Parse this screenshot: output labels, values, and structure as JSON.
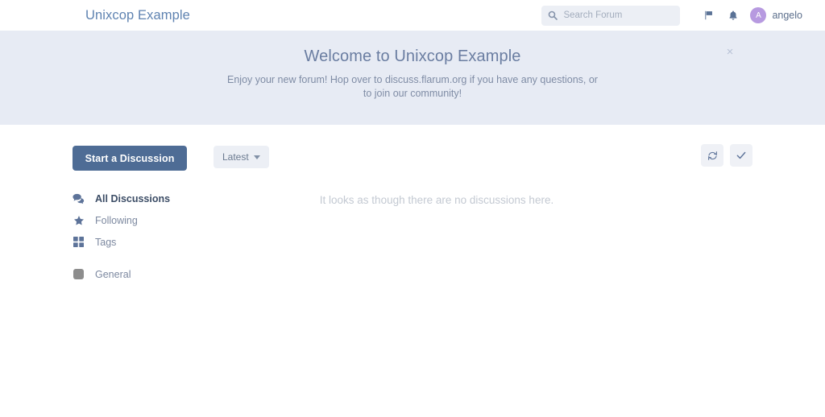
{
  "header": {
    "logo": "Unixcop Example",
    "search": {
      "placeholder": "Search Forum",
      "value": "",
      "icon": "search-icon"
    },
    "flag_icon": "flag-icon",
    "bell_icon": "bell-icon",
    "user": {
      "name": "angelo",
      "avatar_initial": "A",
      "avatar_color": "#b79ae0"
    }
  },
  "hero": {
    "title": "Welcome to Unixcop Example",
    "subtitle": "Enjoy your new forum! Hop over to discuss.flarum.org if you have any questions, or to join our community!",
    "close_label": "×",
    "background": "#e7ebf4"
  },
  "toolbar": {
    "start_discussion_label": "Start a Discussion",
    "start_discussion_color": "#4e6c95",
    "sort_label": "Latest",
    "actions": [
      {
        "name": "refresh-button",
        "icon": "refresh-icon"
      },
      {
        "name": "mark-all-read-button",
        "icon": "check-icon"
      }
    ]
  },
  "sidebar": {
    "items": [
      {
        "label": "All Discussions",
        "icon": "discussions-icon",
        "active": true
      },
      {
        "label": "Following",
        "icon": "star-icon",
        "active": false
      },
      {
        "label": "Tags",
        "icon": "tags-grid-icon",
        "active": false
      }
    ],
    "tags": [
      {
        "label": "General",
        "color": "#8d8d8d"
      }
    ]
  },
  "main": {
    "empty_state": "It looks as though there are no discussions here."
  }
}
